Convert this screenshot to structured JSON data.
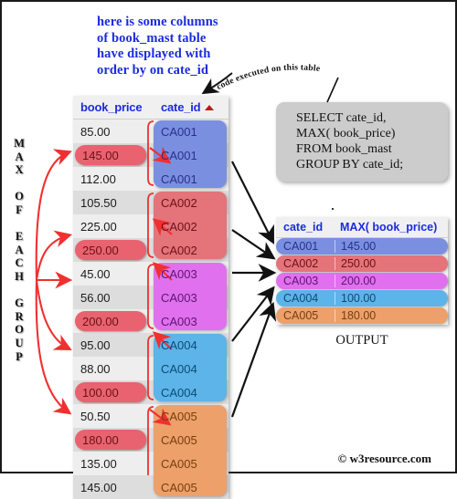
{
  "note": "here is some columns\nof book_mast table\nhave displayed with\norder by on cate_id",
  "curve_label": "code executed on this table",
  "vertical_label": "M\nA\nX\n\nO\nF\n\nE\nA\nC\nH\n\nG\nR\nO\nU\nP",
  "source_table": {
    "headers": {
      "price": "book_price",
      "cate": "cate_id",
      "sort_icon": "sort-ascending-icon"
    },
    "rows": [
      {
        "price": "85.00",
        "cate": "CA001",
        "is_max": false,
        "shade": "lite"
      },
      {
        "price": "145.00",
        "cate": "CA001",
        "is_max": true,
        "shade": "dark"
      },
      {
        "price": "112.00",
        "cate": "CA001",
        "is_max": false,
        "shade": "lite"
      },
      {
        "price": "105.50",
        "cate": "CA002",
        "is_max": false,
        "shade": "dark"
      },
      {
        "price": "225.00",
        "cate": "CA002",
        "is_max": false,
        "shade": "lite"
      },
      {
        "price": "250.00",
        "cate": "CA002",
        "is_max": true,
        "shade": "dark"
      },
      {
        "price": "45.00",
        "cate": "CA003",
        "is_max": false,
        "shade": "lite"
      },
      {
        "price": "56.00",
        "cate": "CA003",
        "is_max": false,
        "shade": "dark"
      },
      {
        "price": "200.00",
        "cate": "CA003",
        "is_max": true,
        "shade": "lite"
      },
      {
        "price": "95.00",
        "cate": "CA004",
        "is_max": false,
        "shade": "dark"
      },
      {
        "price": "88.00",
        "cate": "CA004",
        "is_max": false,
        "shade": "lite"
      },
      {
        "price": "100.00",
        "cate": "CA004",
        "is_max": true,
        "shade": "dark"
      },
      {
        "price": "50.50",
        "cate": "CA005",
        "is_max": false,
        "shade": "lite"
      },
      {
        "price": "180.00",
        "cate": "CA005",
        "is_max": true,
        "shade": "dark"
      },
      {
        "price": "135.00",
        "cate": "CA005",
        "is_max": false,
        "shade": "lite"
      },
      {
        "price": "145.00",
        "cate": "CA005",
        "is_max": false,
        "shade": "dark"
      }
    ],
    "groups": [
      {
        "cate": "CA001",
        "start": 0,
        "count": 3,
        "fill": "#7a8fe0",
        "text": "#2a2f8c"
      },
      {
        "cate": "CA002",
        "start": 3,
        "count": 3,
        "fill": "#e4737a",
        "text": "#6d1218"
      },
      {
        "cate": "CA003",
        "start": 6,
        "count": 3,
        "fill": "#e070ee",
        "text": "#5c1570"
      },
      {
        "cate": "CA004",
        "start": 9,
        "count": 3,
        "fill": "#5cb4e8",
        "text": "#0f4a74"
      },
      {
        "cate": "CA005",
        "start": 12,
        "count": 4,
        "fill": "#eda06a",
        "text": "#76400c"
      }
    ]
  },
  "sql": "SELECT cate_id,\nMAX( book_price)\nFROM book_mast\nGROUP BY cate_id;",
  "output_table": {
    "headers": {
      "c1": "cate_id",
      "c2": "MAX( book_price)"
    },
    "rows": [
      {
        "cate_id": "CA001",
        "max_book_price": "145.00",
        "fill": "#7a8fe0",
        "text": "#2a2f8c"
      },
      {
        "cate_id": "CA002",
        "max_book_price": "250.00",
        "fill": "#e4737a",
        "text": "#6d1218"
      },
      {
        "cate_id": "CA003",
        "max_book_price": "200.00",
        "fill": "#e070ee",
        "text": "#5c1570"
      },
      {
        "cate_id": "CA004",
        "max_book_price": "100.00",
        "fill": "#5cb4e8",
        "text": "#0f4a74"
      },
      {
        "cate_id": "CA005",
        "max_book_price": "180.00",
        "fill": "#eda06a",
        "text": "#76400c"
      }
    ],
    "caption": "OUTPUT"
  },
  "footer": "© w3resource.com",
  "colors": {
    "note_blue": "#1c2ae0",
    "header_blue": "#1c2ae0",
    "max_pill": "#e8636f",
    "arrow_red": "#f03030",
    "arrow_black": "#111111",
    "sql_box": "#cccccc"
  }
}
